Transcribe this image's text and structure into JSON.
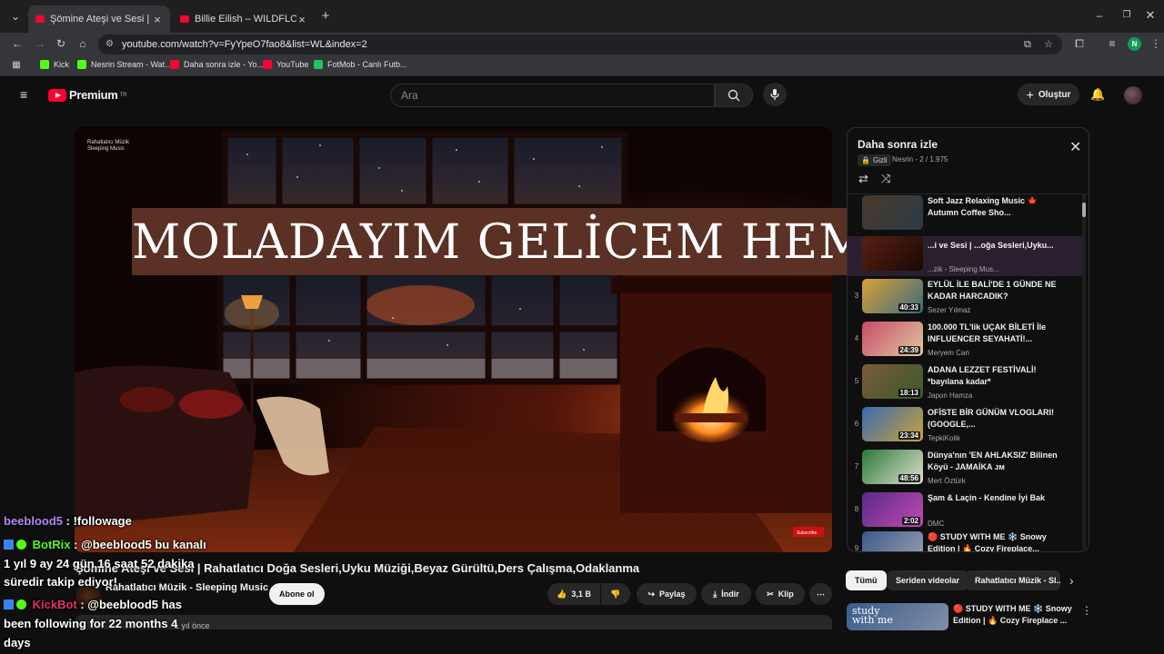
{
  "browser": {
    "tabs": [
      {
        "title": "Şömine Ateşi ve Sesi | Rahatlatıcı",
        "active": true
      },
      {
        "title": "Billie Eilish – WILDFLOWER (Live",
        "active": false
      }
    ],
    "url": "youtube.com/watch?v=FyYpeO7fao8&list=WL&index=2",
    "profile_initial": "N",
    "bookmarks": [
      {
        "label": "Kick",
        "color": "#53fc18"
      },
      {
        "label": "Nesrin Stream - Wat...",
        "color": "#53fc18"
      },
      {
        "label": "Daha sonra izle - Yo...",
        "color": "#ff0033"
      },
      {
        "label": "YouTube",
        "color": "#ff0033"
      },
      {
        "label": "FotMob - Canlı Futb...",
        "color": "#22c55e"
      }
    ]
  },
  "youtube": {
    "logo_text": "Premium",
    "logo_sup": "TR",
    "search_placeholder": "Ara",
    "create_label": "Oluştur"
  },
  "video": {
    "overlay_text": "MOLADAYIM GELİCEM HEMENN",
    "channel_watermark_1": "Rahatlatıcı Müzik",
    "channel_watermark_2": "Sleeping Music",
    "subscribe_tag": "Subscribe",
    "title": "Şömine Ateşi ve Sesi | Rahatlatıcı Doğa Sesleri,Uyku Müziği,Beyaz Gürültü,Ders Çalışma,Odaklanma",
    "channel_name": "Rahatlatıcı Müzik - Sleeping Music",
    "subscribe_label": "Abone ol",
    "like_count": "3,1 B",
    "share_label": "Paylaş",
    "download_label": "İndir",
    "clip_label": "Klip",
    "meta_partial": "1 yıl önce"
  },
  "playlist": {
    "title": "Daha sonra izle",
    "privacy": "Gizli",
    "meta": "Nesrin - 2 / 1.975",
    "items": [
      {
        "index": "",
        "title": "Soft Jazz Relaxing Music 🍁 Autumn Coffee Sho...",
        "channel": "",
        "duration": ""
      },
      {
        "index": "",
        "title": "...i ve Sesi | ...oğa Sesleri,Uyku...",
        "channel": "...zik - Sleeping Mus...",
        "duration": ""
      },
      {
        "index": "3",
        "title": "EYLÜL İLE BALİ'DE 1 GÜNDE NE KADAR HARCADIK?",
        "channel": "Sezer Yılmaz",
        "duration": "40:33"
      },
      {
        "index": "4",
        "title": "100.000 TL'lik UÇAK BİLETİ İle INFLUENCER SEYAHATİ!...",
        "channel": "Meryem Can",
        "duration": "24:39"
      },
      {
        "index": "5",
        "title": "ADANA LEZZET FESTİVALİ! *bayılana kadar*",
        "channel": "Japon Hamza",
        "duration": "18:13"
      },
      {
        "index": "6",
        "title": "OFİSTE BİR GÜNÜM VLOGLARI! (GOOGLE,...",
        "channel": "TepkiKolik",
        "duration": "23:34"
      },
      {
        "index": "7",
        "title": "Dünya'nın 'EN AHLAKSIZ' Bilinen Köyü - JAMAİKA ᴊᴍ",
        "channel": "Mert Öztürk",
        "duration": "48:56"
      },
      {
        "index": "8",
        "title": "Şam & Laçin - Kendine İyi Bak",
        "channel": "DMC",
        "duration": "2:02"
      },
      {
        "index": "9",
        "title": "🔴 STUDY WITH ME ❄️ Snowy Edition | 🔥 Cozy Fireplace...",
        "channel": "",
        "duration": ""
      }
    ]
  },
  "chips": [
    "Tümü",
    "Seriden videolar",
    "Rahatlatıcı Müzik - Sl..."
  ],
  "recommended": {
    "title": "🔴 STUDY WITH ME ❄️ Snowy Edition | 🔥 Cozy Fireplace ...",
    "thumb_text": "study with me"
  },
  "chat": [
    {
      "user": "beeblood5",
      "user_color": "#b18af2",
      "text": " : !followage"
    },
    {
      "user": "BotRix",
      "user_color": "#53fc18",
      "text": " : @beeblood5 bu kanalı"
    },
    {
      "line": "1 yıl 9 ay 24 gün 16 saat 52 dakika"
    },
    {
      "line": "süredir takip ediyor!"
    },
    {
      "user": "KickBot",
      "user_color": "#e0306a",
      "text": " : @beeblood5 has"
    },
    {
      "line": "been following for 22 months 4"
    },
    {
      "line": "days"
    }
  ]
}
